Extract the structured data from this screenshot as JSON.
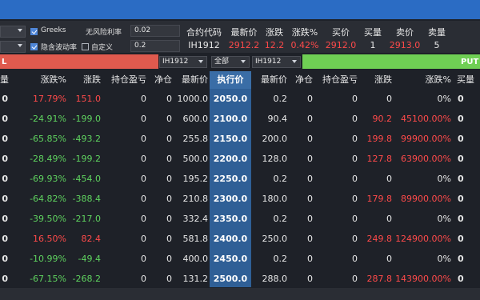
{
  "toolbar": {
    "greeks_label": "Greeks",
    "implied_vol_label": "隐含波动率",
    "custom_label": "自定义",
    "risk_free_label": "无风险利率",
    "risk_free_value": "0.02",
    "param_value": "0.2",
    "greeks_checked": true,
    "implied_vol_checked": true,
    "custom_checked": false
  },
  "quote": {
    "headers": [
      "合约代码",
      "最新价",
      "涨跌",
      "涨跌%",
      "买价",
      "买量",
      "卖价",
      "卖量"
    ],
    "values": [
      "IH1912",
      "2912.2",
      "12.2",
      "0.42%",
      "2912.0",
      "1",
      "2913.0",
      "5"
    ]
  },
  "filters": {
    "call_contract": "IH1912",
    "mode": "全部",
    "put_contract": "IH1912",
    "put_label": "PUT"
  },
  "table": {
    "call_headers": [
      "量",
      "涨跌%",
      "涨跌",
      "持仓盈亏",
      "净仓",
      "最新价"
    ],
    "strike_header": "执行价",
    "put_headers": [
      "最新价",
      "净仓",
      "持仓盈亏",
      "涨跌",
      "涨跌%",
      "买量"
    ],
    "rows": [
      {
        "c_vol": "0",
        "c_pct": "17.79%",
        "c_chg": "151.0",
        "c_pnl": "0",
        "c_net": "0",
        "c_last": "1000.0",
        "strike": "2050.0",
        "p_last": "0.2",
        "p_net": "0",
        "p_pnl": "0",
        "p_chg": "0",
        "p_pct": "0%",
        "p_bid": "0",
        "c_dir": "up",
        "p_dir": "flat"
      },
      {
        "c_vol": "0",
        "c_pct": "-24.91%",
        "c_chg": "-199.0",
        "c_pnl": "0",
        "c_net": "0",
        "c_last": "600.0",
        "strike": "2100.0",
        "p_last": "90.4",
        "p_net": "0",
        "p_pnl": "0",
        "p_chg": "90.2",
        "p_pct": "45100.00%",
        "p_bid": "0",
        "c_dir": "down",
        "p_dir": "up"
      },
      {
        "c_vol": "0",
        "c_pct": "-65.85%",
        "c_chg": "-493.2",
        "c_pnl": "0",
        "c_net": "0",
        "c_last": "255.8",
        "strike": "2150.0",
        "p_last": "200.0",
        "p_net": "0",
        "p_pnl": "0",
        "p_chg": "199.8",
        "p_pct": "99900.00%",
        "p_bid": "0",
        "c_dir": "down",
        "p_dir": "up"
      },
      {
        "c_vol": "0",
        "c_pct": "-28.49%",
        "c_chg": "-199.2",
        "c_pnl": "0",
        "c_net": "0",
        "c_last": "500.0",
        "strike": "2200.0",
        "p_last": "128.0",
        "p_net": "0",
        "p_pnl": "0",
        "p_chg": "127.8",
        "p_pct": "63900.00%",
        "p_bid": "0",
        "c_dir": "down",
        "p_dir": "up"
      },
      {
        "c_vol": "0",
        "c_pct": "-69.93%",
        "c_chg": "-454.0",
        "c_pnl": "0",
        "c_net": "0",
        "c_last": "195.2",
        "strike": "2250.0",
        "p_last": "0.2",
        "p_net": "0",
        "p_pnl": "0",
        "p_chg": "0",
        "p_pct": "0%",
        "p_bid": "0",
        "c_dir": "down",
        "p_dir": "flat"
      },
      {
        "c_vol": "0",
        "c_pct": "-64.82%",
        "c_chg": "-388.4",
        "c_pnl": "0",
        "c_net": "0",
        "c_last": "210.8",
        "strike": "2300.0",
        "p_last": "180.0",
        "p_net": "0",
        "p_pnl": "0",
        "p_chg": "179.8",
        "p_pct": "89900.00%",
        "p_bid": "0",
        "c_dir": "down",
        "p_dir": "up"
      },
      {
        "c_vol": "0",
        "c_pct": "-39.50%",
        "c_chg": "-217.0",
        "c_pnl": "0",
        "c_net": "0",
        "c_last": "332.4",
        "strike": "2350.0",
        "p_last": "0.2",
        "p_net": "0",
        "p_pnl": "0",
        "p_chg": "0",
        "p_pct": "0%",
        "p_bid": "0",
        "c_dir": "down",
        "p_dir": "flat"
      },
      {
        "c_vol": "0",
        "c_pct": "16.50%",
        "c_chg": "82.4",
        "c_pnl": "0",
        "c_net": "0",
        "c_last": "581.8",
        "strike": "2400.0",
        "p_last": "250.0",
        "p_net": "0",
        "p_pnl": "0",
        "p_chg": "249.8",
        "p_pct": "124900.00%",
        "p_bid": "0",
        "c_dir": "up",
        "p_dir": "up"
      },
      {
        "c_vol": "0",
        "c_pct": "-10.99%",
        "c_chg": "-49.4",
        "c_pnl": "0",
        "c_net": "0",
        "c_last": "400.0",
        "strike": "2450.0",
        "p_last": "0.2",
        "p_net": "0",
        "p_pnl": "0",
        "p_chg": "0",
        "p_pct": "0%",
        "p_bid": "0",
        "c_dir": "down",
        "p_dir": "flat"
      },
      {
        "c_vol": "0",
        "c_pct": "-67.15%",
        "c_chg": "-268.2",
        "c_pnl": "0",
        "c_net": "0",
        "c_last": "131.2",
        "strike": "2500.0",
        "p_last": "288.0",
        "p_net": "0",
        "p_pnl": "0",
        "p_chg": "287.8",
        "p_pct": "143900.00%",
        "p_bid": "0",
        "c_dir": "down",
        "p_dir": "up"
      }
    ]
  },
  "colors": {
    "up": "#ff4a4a",
    "down": "#5fd35f",
    "call_bar": "#e05a4e",
    "put_bar": "#6fcf54",
    "strike_col": "#2f5f96",
    "title_bar": "#2b6cc4"
  }
}
